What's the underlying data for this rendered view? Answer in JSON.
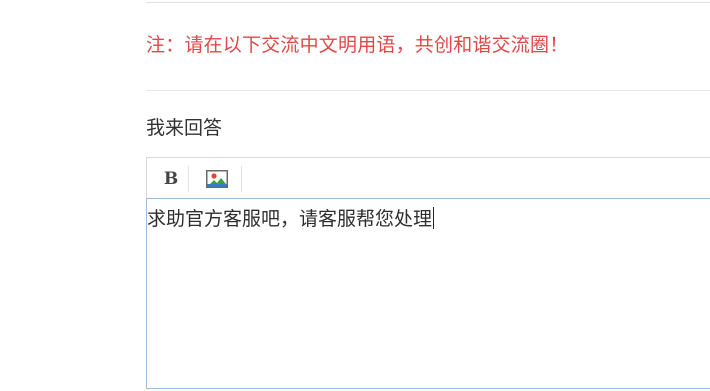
{
  "notice": {
    "text": "注：请在以下交流中文明用语，共创和谐交流圈！",
    "color": "#e04848"
  },
  "answer_section": {
    "heading": "我来回答"
  },
  "editor": {
    "toolbar": {
      "bold_label": "B",
      "bold_icon": "bold-icon",
      "image_icon": "image-icon"
    },
    "content": "求助官方客服吧，请客服帮您处理",
    "focus_border_color": "#9bbcdc"
  }
}
